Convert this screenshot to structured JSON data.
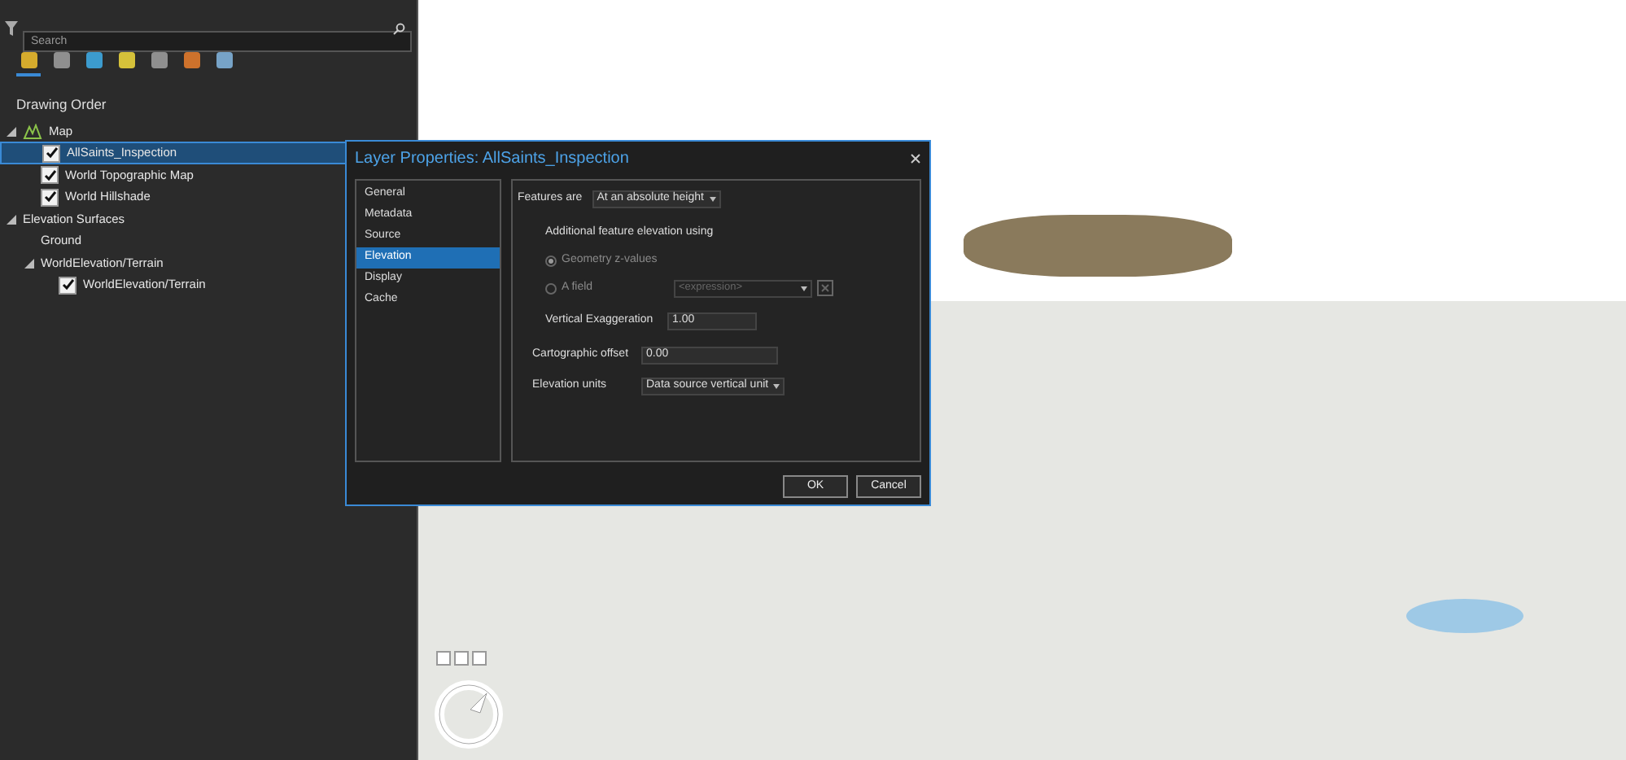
{
  "contents": {
    "search": {
      "placeholder": "Search"
    },
    "view_tabs": [
      {
        "selected": true
      },
      {
        "selected": false
      },
      {
        "selected": false
      },
      {
        "selected": false
      },
      {
        "selected": false
      },
      {
        "selected": false
      },
      {
        "selected": false
      }
    ],
    "heading": "Drawing Order",
    "tree": [
      {
        "label": "Map",
        "kind": "map",
        "expanded": true,
        "children": [
          {
            "label": "AllSaints_Inspection",
            "kind": "checkbox",
            "checked": true,
            "selected": true
          },
          {
            "label": "World Topographic Map",
            "kind": "checkbox",
            "checked": true,
            "selected": false
          },
          {
            "label": "World Hillshade",
            "kind": "checkbox",
            "checked": true,
            "selected": false
          }
        ]
      },
      {
        "label": "Elevation Surfaces",
        "kind": "group",
        "expanded": true,
        "children": [
          {
            "label": "Ground",
            "kind": "plain"
          },
          {
            "label": "WorldElevation/Terrain",
            "kind": "group",
            "expanded": true,
            "children": [
              {
                "label": "WorldElevation/Terrain",
                "kind": "checkbox",
                "checked": true,
                "selected": false
              }
            ]
          }
        ]
      }
    ]
  },
  "dialog": {
    "title": "Layer Properties: AllSaints_Inspection",
    "pages": [
      {
        "label": "General",
        "selected": false
      },
      {
        "label": "Metadata",
        "selected": false
      },
      {
        "label": "Source",
        "selected": false
      },
      {
        "label": "Elevation",
        "selected": true
      },
      {
        "label": "Display",
        "selected": false
      },
      {
        "label": "Cache",
        "selected": false
      }
    ],
    "features_are": {
      "label": "Features are",
      "value": "At an absolute height"
    },
    "additional_label": "Additional feature elevation using",
    "options": [
      {
        "label": "Geometry z-values",
        "selected": true,
        "disabled": true
      },
      {
        "label": "A field",
        "selected": false,
        "disabled": true
      }
    ],
    "expression": {
      "placeholder": "<expression>",
      "disabled": true
    },
    "vertical_exaggeration": {
      "label": "Vertical Exaggeration",
      "value": "1.00"
    },
    "cartographic_offset": {
      "label": "Cartographic offset",
      "value": "0.00"
    },
    "elevation_units": {
      "label": "Elevation units",
      "value": "Data source vertical unit"
    },
    "buttons": [
      "OK",
      "Cancel"
    ]
  }
}
